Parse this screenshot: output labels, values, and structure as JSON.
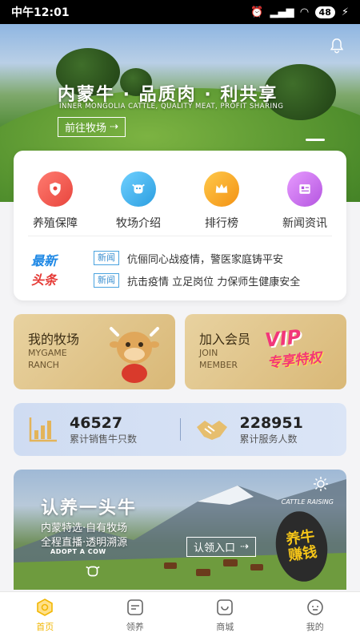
{
  "status_bar": {
    "time": "中午12:01",
    "battery": "48"
  },
  "hero": {
    "headline": "内蒙牛 · 品质肉 · 利共享",
    "subline": "INNER MONGOLIA CATTLE, QUALITY MEAT, PROFIT SHARING",
    "button_label": "前往牧场",
    "bell_icon": "bell-icon"
  },
  "menu": [
    {
      "label": "养殖保障",
      "icon": "shield-icon",
      "color": "#f0605a"
    },
    {
      "label": "牧场介绍",
      "icon": "cow-icon",
      "color": "#3fb2ec"
    },
    {
      "label": "排行榜",
      "icon": "crown-icon",
      "color": "#f7a21b"
    },
    {
      "label": "新闻资讯",
      "icon": "news-icon",
      "color": "#c86be8"
    }
  ],
  "news": {
    "logo_line1": "最新",
    "logo_line2": "头条",
    "items": [
      {
        "tag": "新闻",
        "text": "伉俪同心战疫情，警医家庭铸平安"
      },
      {
        "tag": "新闻",
        "text": "抗击疫情 立足岗位 力保师生健康安全"
      }
    ]
  },
  "promos": {
    "ranch": {
      "title": "我的牧场",
      "en1": "MYGAME",
      "en2": "RANCH"
    },
    "member": {
      "title": "加入会员",
      "en1": "JOIN",
      "en2": "MEMBER",
      "badge": "VIP",
      "badge_sub": "专享特权"
    }
  },
  "stats": [
    {
      "value": "46527",
      "label": "累计销售牛只数",
      "icon": "bar-chart-icon"
    },
    {
      "value": "228951",
      "label": "累计服务人数",
      "icon": "handshake-icon"
    }
  ],
  "adopt": {
    "title": "认养一头牛",
    "line1": "内蒙特选·自有牧场",
    "line2": "全程直播·透明溯源",
    "en": "ADOPT A COW",
    "button_label": "认领入口",
    "raising": "CATTLE RAISING",
    "badge": [
      "养",
      "牛",
      "赚",
      "钱"
    ]
  },
  "tabs": [
    {
      "label": "首页",
      "icon": "home-icon",
      "active": true
    },
    {
      "label": "领养",
      "icon": "adopt-icon",
      "active": false
    },
    {
      "label": "商城",
      "icon": "shop-icon",
      "active": false
    },
    {
      "label": "我的",
      "icon": "profile-icon",
      "active": false
    }
  ],
  "colors": {
    "accent": "#f2b705",
    "tag_blue": "#3a8fd0",
    "card_gold": "#d9b877"
  }
}
